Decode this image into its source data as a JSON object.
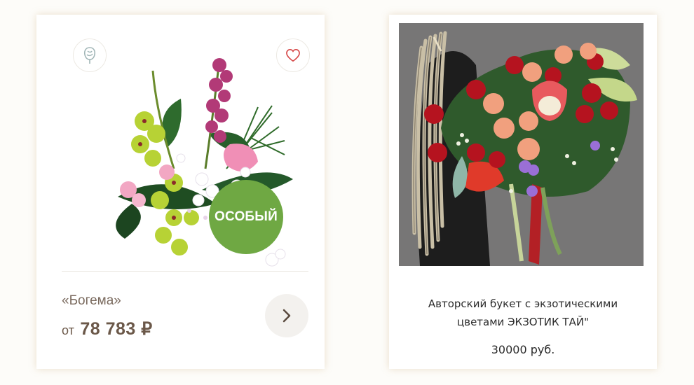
{
  "products": [
    {
      "name": "«Богема»",
      "price_prefix": "от",
      "price_value": "78 783 ₽",
      "badge": "ОСОБЫЙ",
      "badge_color": "#6fa843",
      "icons": [
        "rose-icon",
        "heart-icon",
        "chevron-right-icon"
      ]
    },
    {
      "title_line1": "Авторский букет с экзотическими",
      "title_line2": "цветами ЭКЗОТИК ТАЙ\"",
      "price": "30000 руб."
    }
  ]
}
